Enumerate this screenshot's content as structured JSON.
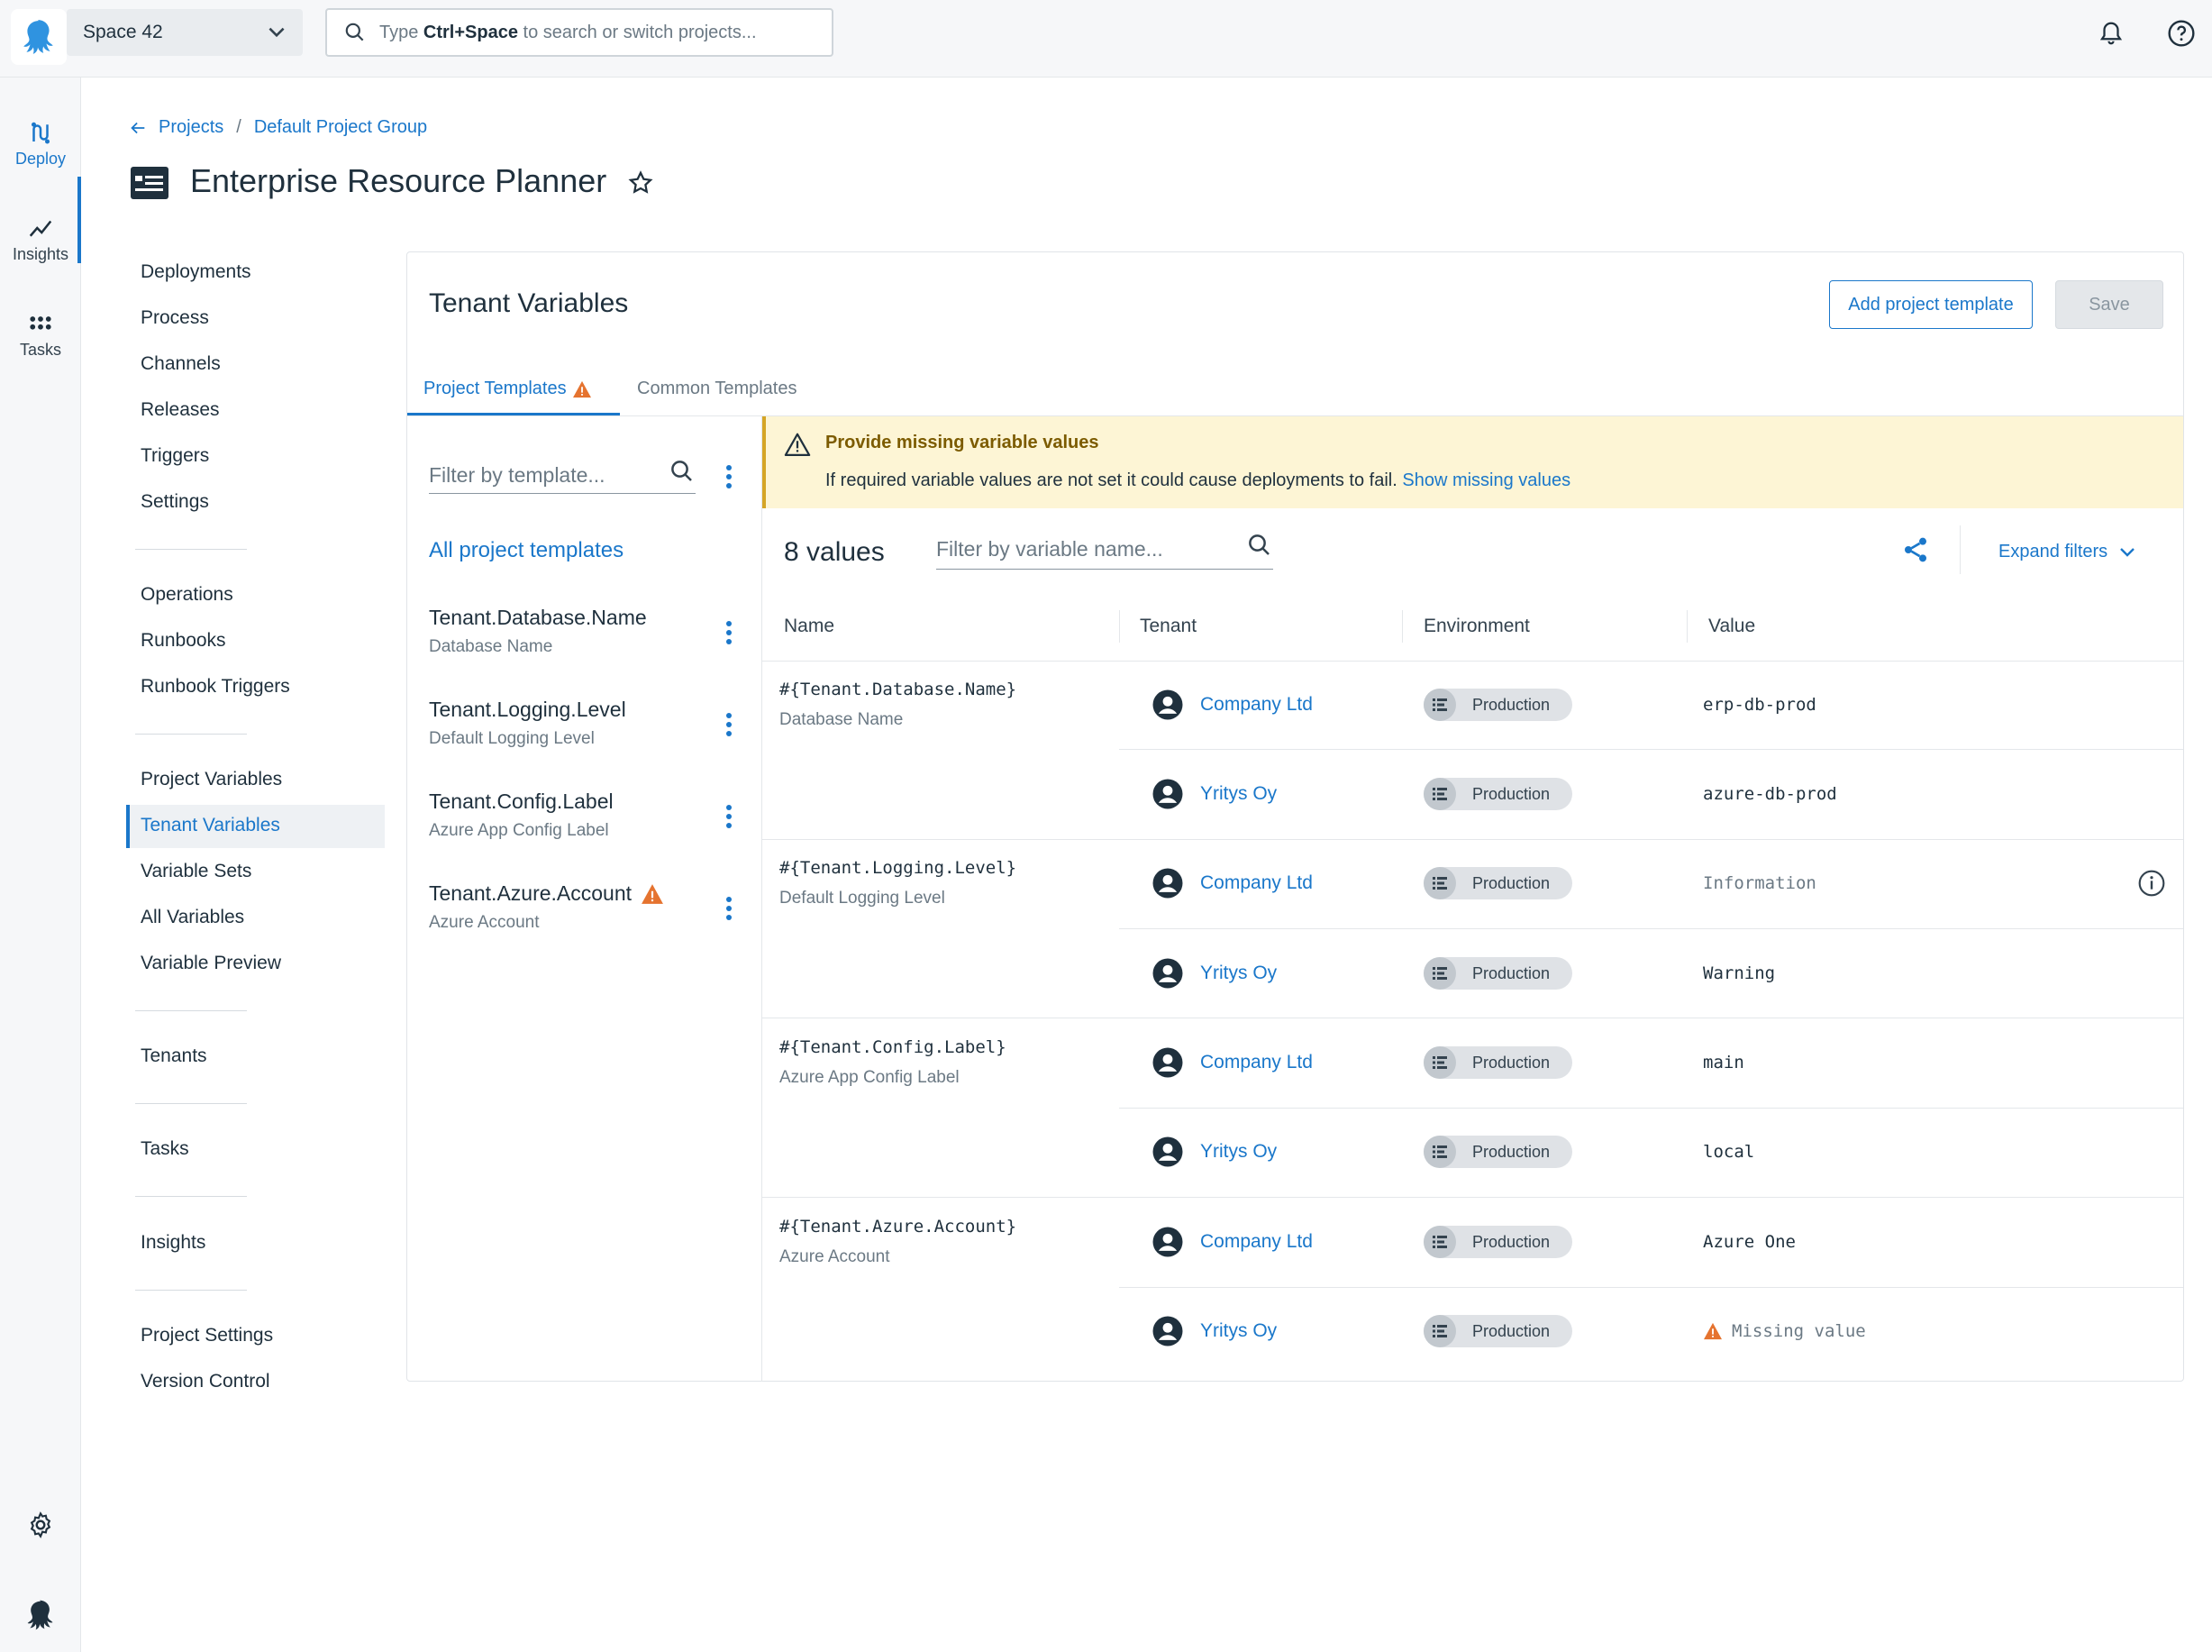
{
  "topbar": {
    "space_name": "Space 42",
    "search_prefix": "Type ",
    "search_shortcut": "Ctrl+Space",
    "search_suffix": " to search or switch projects..."
  },
  "rail": {
    "deploy": "Deploy",
    "insights": "Insights",
    "tasks": "Tasks"
  },
  "breadcrumb": {
    "projects": "Projects",
    "group": "Default Project Group"
  },
  "page_title": "Enterprise Resource Planner",
  "sidenav": {
    "items": [
      "Deployments",
      "Process",
      "Channels",
      "Releases",
      "Triggers",
      "Settings",
      "Operations",
      "Runbooks",
      "Runbook Triggers",
      "Project Variables",
      "Tenant Variables",
      "Variable Sets",
      "All Variables",
      "Variable Preview",
      "Tenants",
      "Tasks",
      "Insights",
      "Project Settings",
      "Version Control"
    ]
  },
  "card": {
    "title": "Tenant Variables",
    "add_button": "Add project template",
    "save_button": "Save",
    "tabs": [
      "Project Templates",
      "Common Templates"
    ]
  },
  "templates": {
    "filter_placeholder": "Filter by template...",
    "all_label": "All project templates",
    "items": [
      {
        "name": "Tenant.Database.Name",
        "desc": "Database Name"
      },
      {
        "name": "Tenant.Logging.Level",
        "desc": "Default Logging Level"
      },
      {
        "name": "Tenant.Config.Label",
        "desc": "Azure App Config Label"
      },
      {
        "name": "Tenant.Azure.Account",
        "desc": "Azure Account"
      }
    ]
  },
  "warning": {
    "title": "Provide missing variable values",
    "body": "If required variable values are not set it could cause deployments to fail. ",
    "link": "Show missing values"
  },
  "values": {
    "count_label": "8 values",
    "filter_placeholder": "Filter by variable name...",
    "expand_filters": "Expand filters",
    "headers": [
      "Name",
      "Tenant",
      "Environment",
      "Value"
    ],
    "variables": [
      {
        "name": "#{Tenant.Database.Name}",
        "desc": "Database Name"
      },
      {
        "name": "#{Tenant.Logging.Level}",
        "desc": "Default Logging Level"
      },
      {
        "name": "#{Tenant.Config.Label}",
        "desc": "Azure App Config Label"
      },
      {
        "name": "#{Tenant.Azure.Account}",
        "desc": "Azure Account"
      }
    ],
    "rows": [
      {
        "tenant": "Company Ltd",
        "env": "Production",
        "value": "erp-db-prod"
      },
      {
        "tenant": "Yritys Oy",
        "env": "Production",
        "value": "azure-db-prod"
      },
      {
        "tenant": "Company Ltd",
        "env": "Production",
        "value": "Information"
      },
      {
        "tenant": "Yritys Oy",
        "env": "Production",
        "value": "Warning"
      },
      {
        "tenant": "Company Ltd",
        "env": "Production",
        "value": "main"
      },
      {
        "tenant": "Yritys Oy",
        "env": "Production",
        "value": "local"
      },
      {
        "tenant": "Company Ltd",
        "env": "Production",
        "value": "Azure One"
      },
      {
        "tenant": "Yritys Oy",
        "env": "Production",
        "value": "Missing value"
      }
    ]
  },
  "colors": {
    "accent": "#1a77ca",
    "warning": "#e5732f",
    "banner_bg": "#fdf5d5"
  }
}
